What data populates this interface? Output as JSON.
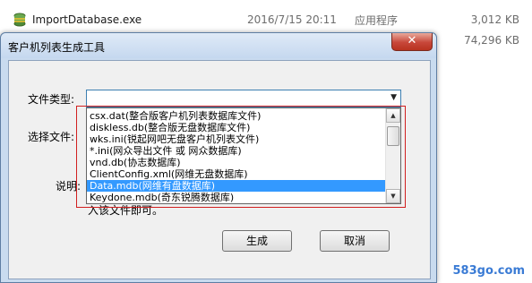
{
  "explorer": {
    "rows": [
      {
        "name": "ImportDatabase.exe",
        "date": "2016/7/15 20:11",
        "type": "应用程序",
        "size": "3,012 KB"
      },
      {
        "name": "",
        "date": "",
        "type": "",
        "size": "74,296 KB"
      }
    ]
  },
  "dialog": {
    "title": "客户机列表生成工具",
    "close_label": "✕",
    "file_type_label": "文件类型:",
    "select_file_label": "选择文件:",
    "desc_label": "说明:",
    "desc_tail": "入该文件即可。",
    "combo_value": "",
    "options": [
      "csx.dat(整合版客户机列表数据库文件)",
      "diskless.db(整合版无盘数据库文件)",
      "wks.ini(锐起网吧无盘客户机列表文件)",
      "*.ini(网众导出文件 或 网众数据库)",
      "vnd.db(协志数据库)",
      "ClientConfig.xml(网维无盘数据库)",
      "Data.mdb(网维有盘数据库)",
      "Keydone.mdb(奇东锐腾数据库)"
    ],
    "selected_index": 6,
    "generate_button": "生成",
    "cancel_button": "取消"
  },
  "watermark": "583go.com",
  "colors": {
    "selection": "#3399ff",
    "highlight_border": "#d11f1f",
    "close_button": "#c8473a"
  },
  "icons": {
    "exe_icon": "database-exe-icon",
    "second_icon": "archive-icon"
  }
}
